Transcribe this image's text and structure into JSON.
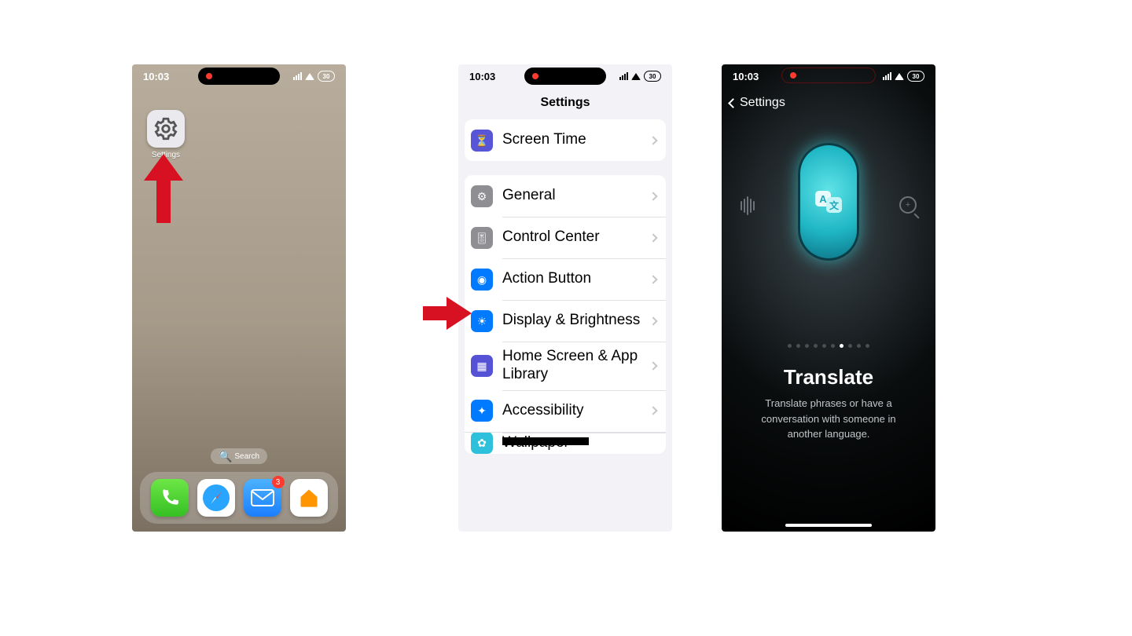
{
  "status": {
    "time": "10:03",
    "battery": "30"
  },
  "home": {
    "settings_label": "Settings",
    "search_label": "Search",
    "dock": {
      "phone": "phone-icon",
      "safari": "safari-icon",
      "mail": "mail-icon",
      "mail_badge": "3",
      "home_app": "home-app-icon"
    }
  },
  "settings": {
    "title": "Settings",
    "rows": {
      "screen_time": "Screen Time",
      "general": "General",
      "control_center": "Control Center",
      "action_button": "Action Button",
      "display_brightness": "Display & Brightness",
      "home_screen": "Home Screen & App Library",
      "accessibility": "Accessibility",
      "wallpaper": "Wallpaper"
    },
    "icon_colors": {
      "screen_time": "#5856d6",
      "general": "#8e8e93",
      "control_center": "#8e8e93",
      "action_button": "#007aff",
      "display_brightness": "#007aff",
      "home_screen": "#5552d6",
      "accessibility": "#007aff",
      "wallpaper": "#2fc1dc"
    }
  },
  "action_button": {
    "back_label": "Settings",
    "title": "Translate",
    "description": "Translate phrases or have a conversation with someone in another language.",
    "page_count": 10,
    "active_page_index": 6
  },
  "annotations": {
    "arrow1": "points to Settings app icon",
    "arrow2": "points to Action Button row"
  }
}
